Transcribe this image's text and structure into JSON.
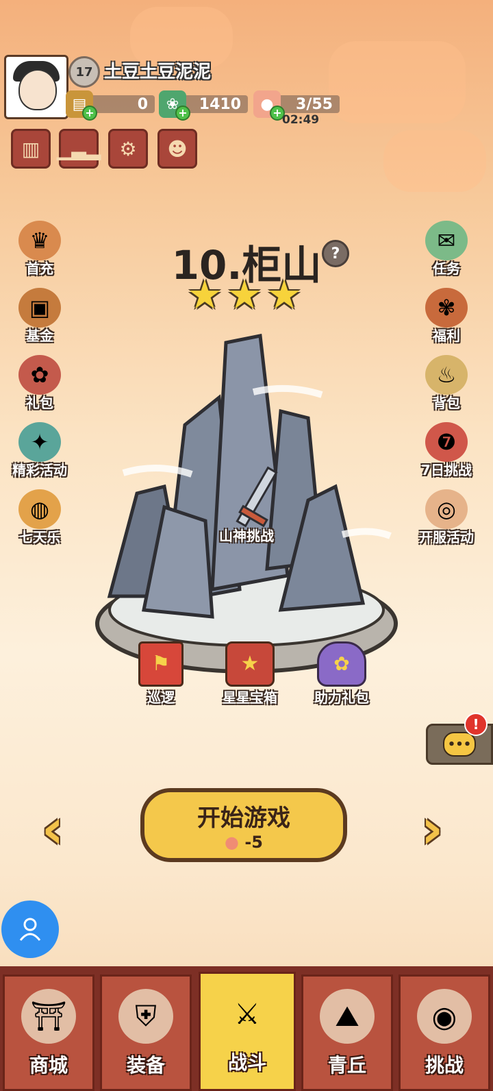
{
  "player": {
    "level": "17",
    "name": "土豆土豆泥泥",
    "resources": [
      {
        "icon": "ticket-icon",
        "value": "0"
      },
      {
        "icon": "jade-icon",
        "value": "1410"
      },
      {
        "icon": "peach-icon",
        "value": "3/55"
      }
    ],
    "stamina_timer": "02:49"
  },
  "top_tools": [
    "cards-icon",
    "rank-icon",
    "settings-icon",
    "friends-icon"
  ],
  "left_menu": [
    {
      "label": "首充",
      "icon": "first-charge-icon"
    },
    {
      "label": "基金",
      "icon": "fund-icon"
    },
    {
      "label": "礼包",
      "icon": "gift-pack-icon"
    },
    {
      "label": "精彩活动",
      "icon": "event-icon"
    },
    {
      "label": "七天乐",
      "icon": "seven-day-icon"
    }
  ],
  "right_menu": [
    {
      "label": "任务",
      "icon": "task-icon"
    },
    {
      "label": "福利",
      "icon": "welfare-icon"
    },
    {
      "label": "背包",
      "icon": "bag-icon"
    },
    {
      "label": "7日挑战",
      "icon": "seven-day-challenge-icon"
    },
    {
      "label": "开服活动",
      "icon": "server-open-icon"
    }
  ],
  "stage": {
    "title": "10.柜山",
    "stars": "★★★",
    "boss_label": "山神挑战",
    "actions": [
      {
        "label": "巡逻",
        "icon": "patrol-flag-icon"
      },
      {
        "label": "星星宝箱",
        "icon": "star-chest-icon"
      },
      {
        "label": "助力礼包",
        "icon": "assist-gift-icon"
      }
    ]
  },
  "start": {
    "label": "开始游戏",
    "cost": "-5"
  },
  "nav": [
    {
      "label": "商城",
      "icon": "shop-icon"
    },
    {
      "label": "装备",
      "icon": "equipment-icon"
    },
    {
      "label": "战斗",
      "icon": "battle-icon"
    },
    {
      "label": "青丘",
      "icon": "qingqiu-icon"
    },
    {
      "label": "挑战",
      "icon": "challenge-icon"
    }
  ],
  "colors": {
    "accent": "#f6d24a",
    "nav_bg": "#7d2f25",
    "nav_item": "#b9533f"
  }
}
